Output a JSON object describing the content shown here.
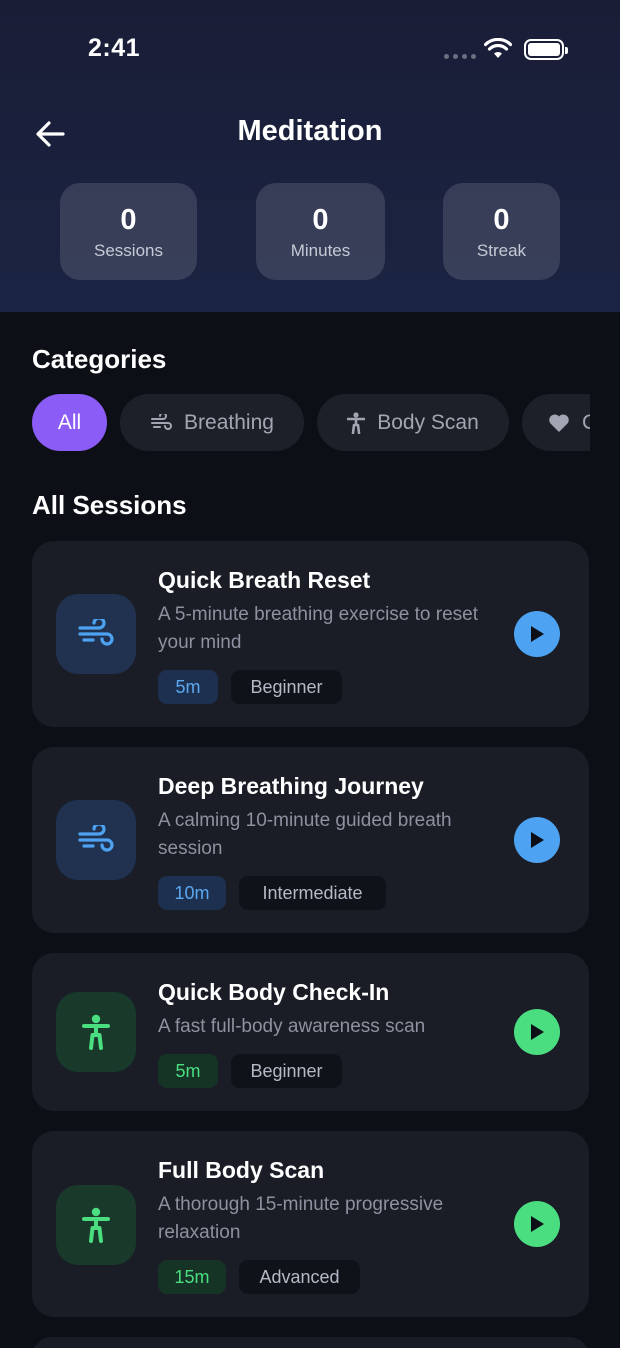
{
  "status_bar": {
    "time": "2:41"
  },
  "header": {
    "title": "Meditation"
  },
  "stats": [
    {
      "value": "0",
      "label": "Sessions"
    },
    {
      "value": "0",
      "label": "Minutes"
    },
    {
      "value": "0",
      "label": "Streak"
    }
  ],
  "categories": {
    "heading": "Categories",
    "chips": [
      {
        "label": "All",
        "icon": "none",
        "active": true
      },
      {
        "label": "Breathing",
        "icon": "wind-icon"
      },
      {
        "label": "Body Scan",
        "icon": "person-icon"
      },
      {
        "label": "C",
        "icon": "heart-icon"
      }
    ]
  },
  "sessions": {
    "heading": "All Sessions",
    "items": [
      {
        "title": "Quick Breath Reset",
        "description": "A 5-minute breathing exercise to reset your mind",
        "duration": "5m",
        "level": "Beginner",
        "icon": "wind-icon",
        "accent": "#4da3f2"
      },
      {
        "title": "Deep Breathing Journey",
        "description": "A calming 10-minute guided breath session",
        "duration": "10m",
        "level": "Intermediate",
        "icon": "wind-icon",
        "accent": "#4da3f2"
      },
      {
        "title": "Quick Body Check-In",
        "description": "A fast full-body awareness scan",
        "duration": "5m",
        "level": "Beginner",
        "icon": "person-icon",
        "accent": "#4ade80"
      },
      {
        "title": "Full Body Scan",
        "description": "A thorough 15-minute progressive relaxation",
        "duration": "15m",
        "level": "Advanced",
        "icon": "person-icon",
        "accent": "#4ade80"
      }
    ]
  }
}
